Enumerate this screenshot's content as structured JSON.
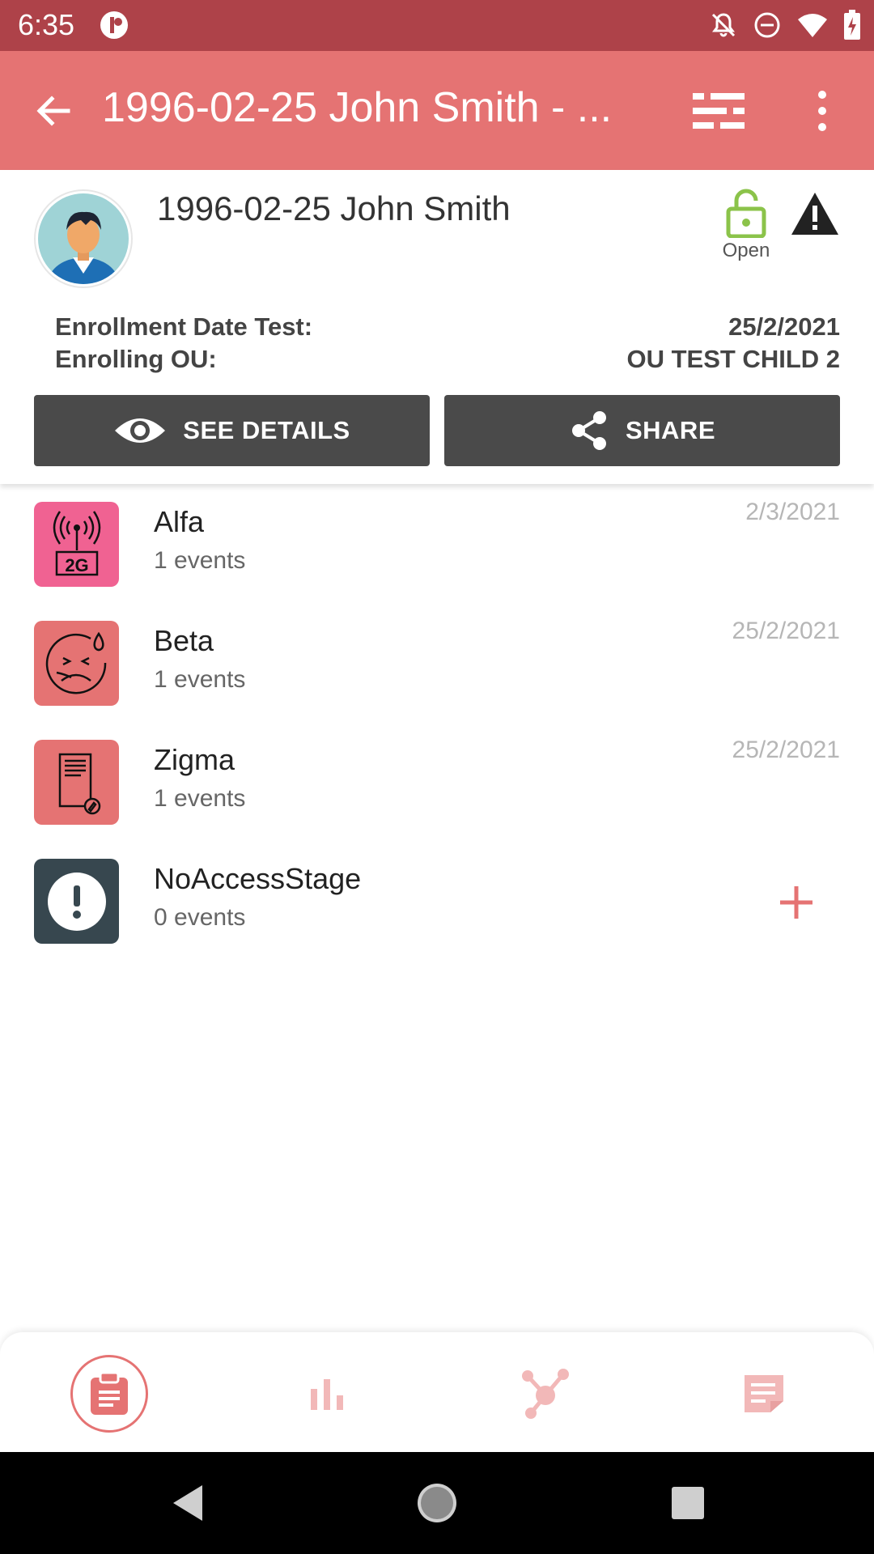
{
  "status_bar": {
    "time": "6:35"
  },
  "app_bar": {
    "title": "1996-02-25 John Smith - ..."
  },
  "header": {
    "name": "1996-02-25 John Smith",
    "lock_label": "Open",
    "enrollment_date_label": "Enrollment Date Test:",
    "enrollment_date_value": "25/2/2021",
    "enrolling_ou_label": "Enrolling OU:",
    "enrolling_ou_value": "OU TEST CHILD 2",
    "see_details_label": "SEE DETAILS",
    "share_label": "SHARE"
  },
  "stages": [
    {
      "name": "Alfa",
      "events": "1 events",
      "date": "2/3/2021",
      "icon": "antenna-2g-icon",
      "color": "#f06292"
    },
    {
      "name": "Beta",
      "events": "1 events",
      "date": "25/2/2021",
      "icon": "sick-face-icon",
      "color": "#e57373"
    },
    {
      "name": "Zigma",
      "events": "1 events",
      "date": "25/2/2021",
      "icon": "document-edit-icon",
      "color": "#e57373"
    },
    {
      "name": "NoAccessStage",
      "events": "0 events",
      "date": "",
      "icon": "alert-icon",
      "color": "#37474f"
    }
  ],
  "bottom_nav": {
    "items": [
      {
        "id": "stages",
        "icon": "clipboard-icon",
        "active": true
      },
      {
        "id": "indicators",
        "icon": "bar-chart-icon",
        "active": false
      },
      {
        "id": "relationships",
        "icon": "relationship-icon",
        "active": false
      },
      {
        "id": "notes",
        "icon": "note-icon",
        "active": false
      }
    ]
  },
  "colors": {
    "status_bar": "#ae4249",
    "primary": "#e57373",
    "button_dark": "#4a4a4a",
    "lock_open": "#8bc34a",
    "nav_inactive": "#f2b8b8"
  }
}
